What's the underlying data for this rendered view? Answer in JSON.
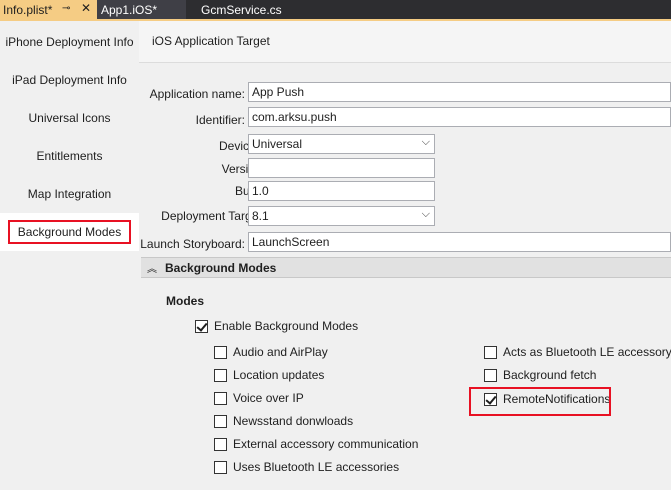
{
  "tabs": [
    {
      "label": "Info.plist*",
      "pin": "⊸",
      "close": "✕"
    },
    {
      "label": "App1.iOS*"
    },
    {
      "label": "GcmService.cs"
    }
  ],
  "sidebar": {
    "items": [
      {
        "label": "iPhone Deployment Info"
      },
      {
        "label": "iPad Deployment Info"
      },
      {
        "label": "Universal Icons"
      },
      {
        "label": "Entitlements"
      },
      {
        "label": "Map Integration"
      },
      {
        "label": "Background Modes"
      }
    ],
    "selected": "Background Modes"
  },
  "main": {
    "section_title": "iOS Application Target",
    "form": {
      "app_name_label": "Application name:",
      "app_name_value": "App Push",
      "identifier_label": "Identifier:",
      "identifier_value": "com.arksu.push",
      "devices_label": "Devices:",
      "devices_value": "Universal",
      "version_label": "Version:",
      "version_value": "",
      "build_label": "Build:",
      "build_value": "1.0",
      "deployment_target_label": "Deployment Target:",
      "deployment_target_value": "8.1",
      "launch_storyboard_label": "Launch Storyboard:",
      "launch_storyboard_value": "LaunchScreen"
    },
    "background_modes": {
      "header": "Background Modes",
      "modes_label": "Modes",
      "enable_label": "Enable Background Modes",
      "enable_checked": true,
      "options_left": [
        {
          "label": "Audio and AirPlay",
          "checked": false
        },
        {
          "label": "Location updates",
          "checked": false
        },
        {
          "label": "Voice over IP",
          "checked": false
        },
        {
          "label": "Newsstand donwloads",
          "checked": false
        },
        {
          "label": "External accessory communication",
          "checked": false
        },
        {
          "label": "Uses Bluetooth LE accessories",
          "checked": false
        }
      ],
      "options_right": [
        {
          "label": "Acts as Bluetooth LE accessory",
          "checked": false
        },
        {
          "label": "Background fetch",
          "checked": false
        },
        {
          "label": "RemoteNotifications",
          "checked": true
        }
      ]
    }
  },
  "colors": {
    "active_tab": "#f5cc84",
    "tab_strip": "#2d2d30",
    "highlight_red": "#e81123",
    "panel_bg": "#f0f0f0"
  }
}
